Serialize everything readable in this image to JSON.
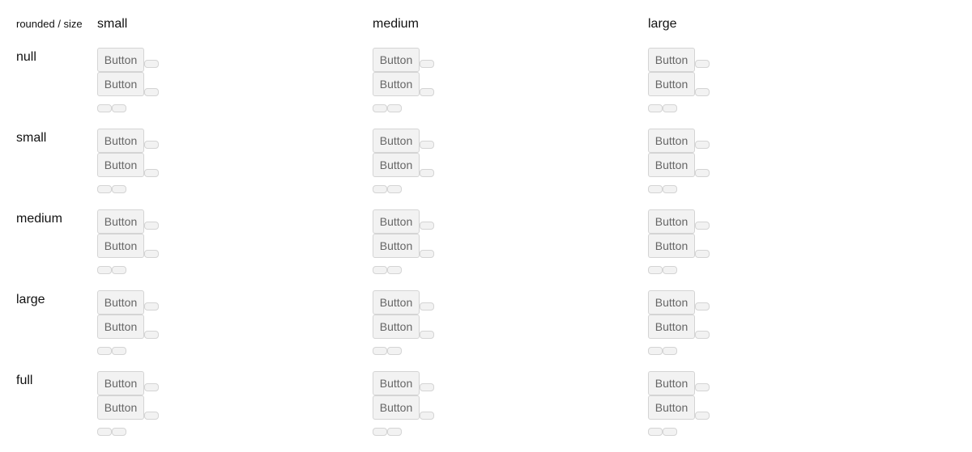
{
  "corner_label": "rounded / size",
  "columns": [
    "small",
    "medium",
    "large"
  ],
  "rows": [
    "null",
    "small",
    "medium",
    "large",
    "full"
  ],
  "button_label": "Button",
  "colors": {
    "button_bg": "#f2f2f2",
    "button_border": "#d4d4d4",
    "button_text": "#666666"
  }
}
